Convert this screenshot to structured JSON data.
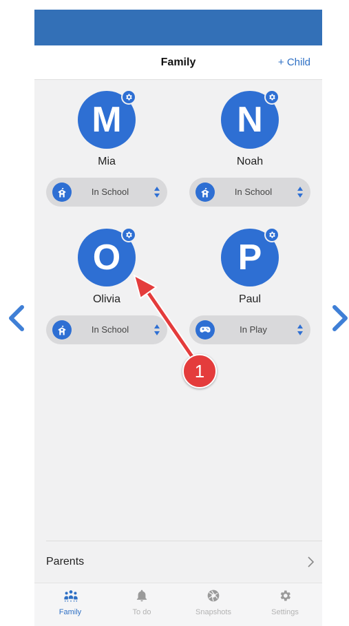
{
  "header": {
    "title": "Family",
    "add_child_label": "+ Child"
  },
  "children": [
    {
      "initial": "M",
      "name": "Mia",
      "mode": "In School",
      "mode_icon": "school-icon"
    },
    {
      "initial": "N",
      "name": "Noah",
      "mode": "In School",
      "mode_icon": "school-icon"
    },
    {
      "initial": "O",
      "name": "Olivia",
      "mode": "In School",
      "mode_icon": "school-icon"
    },
    {
      "initial": "P",
      "name": "Paul",
      "mode": "In Play",
      "mode_icon": "gamepad-icon"
    }
  ],
  "parents": {
    "label": "Parents"
  },
  "tabs": [
    {
      "label": "Family",
      "icon": "family-icon",
      "active": true
    },
    {
      "label": "To do",
      "icon": "bell-icon",
      "active": false
    },
    {
      "label": "Snapshots",
      "icon": "camera-aperture-icon",
      "active": false
    },
    {
      "label": "Settings",
      "icon": "gear-icon",
      "active": false
    }
  ],
  "annotation": {
    "step_number": "1"
  },
  "colors": {
    "accent": "#2e6fd3",
    "status_bar": "#3370b7",
    "annotation_red": "#e43c3c"
  }
}
